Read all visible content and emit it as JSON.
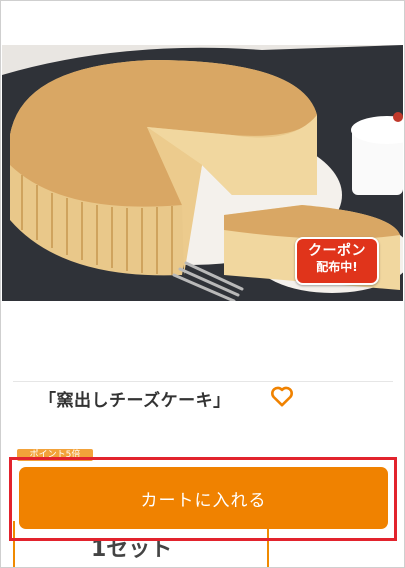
{
  "hero": {
    "coupon_line1": "クーポン",
    "coupon_line2": "配布中!"
  },
  "product": {
    "title": "「窯出しチーズケーキ」",
    "favorite_icon": "heart-icon"
  },
  "badge": {
    "label": "ポイント5倍"
  },
  "partial_box": {
    "text": "1セット"
  },
  "cart": {
    "button_label": "カートに入れる"
  },
  "colors": {
    "accent": "#f08200",
    "highlight": "#e2232d",
    "coupon": "#e0341b"
  }
}
